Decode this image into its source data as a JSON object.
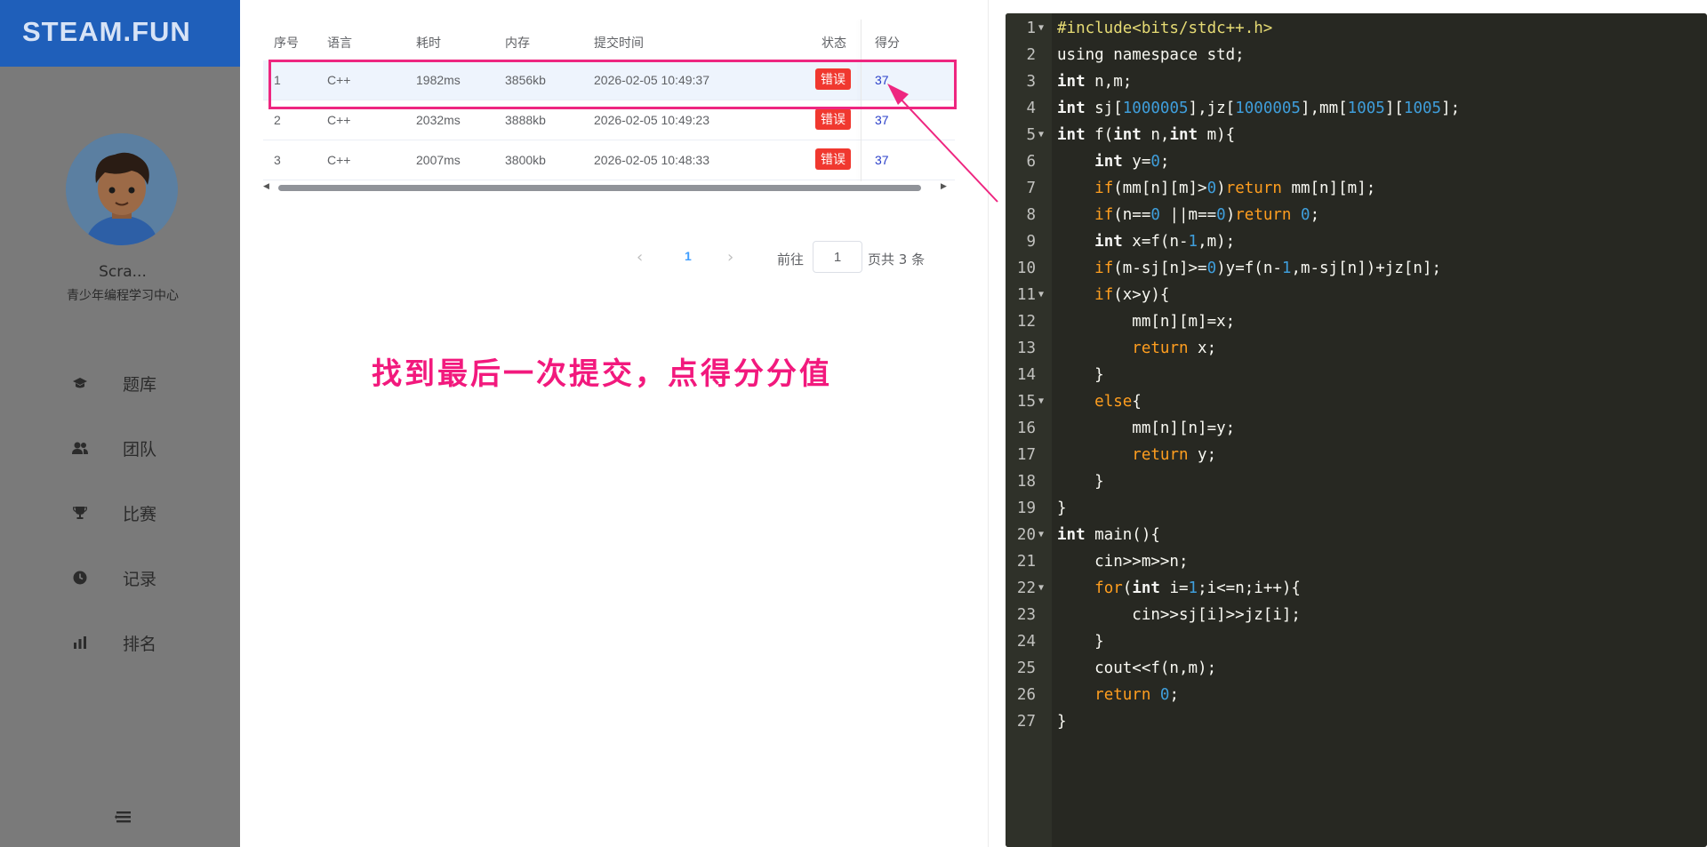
{
  "sidebar": {
    "logo": "STEAM.FUN",
    "user_name": "Scra...",
    "user_org": "青少年编程学习中心",
    "nav": [
      {
        "label": "题库",
        "icon": "question-bank-icon"
      },
      {
        "label": "团队",
        "icon": "team-icon"
      },
      {
        "label": "比赛",
        "icon": "trophy-icon"
      },
      {
        "label": "记录",
        "icon": "clock-icon"
      },
      {
        "label": "排名",
        "icon": "bar-chart-icon"
      }
    ],
    "collapse_icon": "menu-collapse-icon"
  },
  "table": {
    "headers": [
      "序号",
      "语言",
      "耗时",
      "内存",
      "提交时间",
      "状态",
      "得分"
    ],
    "rows": [
      {
        "index": "1",
        "lang": "C++",
        "time": "1982ms",
        "memory": "3856kb",
        "submitted": "2026-02-05 10:49:37",
        "status": "错误",
        "score": "37"
      },
      {
        "index": "2",
        "lang": "C++",
        "time": "2032ms",
        "memory": "3888kb",
        "submitted": "2026-02-05 10:49:23",
        "status": "错误",
        "score": "37"
      },
      {
        "index": "3",
        "lang": "C++",
        "time": "2007ms",
        "memory": "3800kb",
        "submitted": "2026-02-05 10:48:33",
        "status": "错误",
        "score": "37"
      }
    ]
  },
  "pagination": {
    "current": "1",
    "goto_label": "前往",
    "goto_value": "1",
    "total_label": "页共 3 条"
  },
  "annotation": {
    "text": "找到最后一次提交，点得分分值",
    "color": "#ee2680"
  },
  "editor": {
    "lines": [
      {
        "n": "1",
        "fold": true
      },
      {
        "n": "2",
        "fold": false
      },
      {
        "n": "3",
        "fold": false
      },
      {
        "n": "4",
        "fold": false
      },
      {
        "n": "5",
        "fold": true
      },
      {
        "n": "6",
        "fold": false
      },
      {
        "n": "7",
        "fold": false
      },
      {
        "n": "8",
        "fold": false
      },
      {
        "n": "9",
        "fold": false
      },
      {
        "n": "10",
        "fold": false
      },
      {
        "n": "11",
        "fold": true
      },
      {
        "n": "12",
        "fold": false
      },
      {
        "n": "13",
        "fold": false
      },
      {
        "n": "14",
        "fold": false
      },
      {
        "n": "15",
        "fold": true
      },
      {
        "n": "16",
        "fold": false
      },
      {
        "n": "17",
        "fold": false
      },
      {
        "n": "18",
        "fold": false
      },
      {
        "n": "19",
        "fold": false
      },
      {
        "n": "20",
        "fold": true
      },
      {
        "n": "21",
        "fold": false
      },
      {
        "n": "22",
        "fold": true
      },
      {
        "n": "23",
        "fold": false
      },
      {
        "n": "24",
        "fold": false
      },
      {
        "n": "25",
        "fold": false
      },
      {
        "n": "26",
        "fold": false
      },
      {
        "n": "27",
        "fold": false
      }
    ],
    "code": [
      "#include<bits/stdc++.h>",
      "using namespace std;",
      "int n,m;",
      "int sj[1000005],jz[1000005],mm[1005][1005];",
      "int f(int n,int m){",
      "    int y=0;",
      "    if(mm[n][m]>0)return mm[n][m];",
      "    if(n==0 ||m==0)return 0;",
      "    int x=f(n-1,m);",
      "    if(m-sj[n]>=0)y=f(n-1,m-sj[n])+jz[n];",
      "    if(x>y){",
      "        mm[n][m]=x;",
      "        return x;",
      "    }",
      "    else{",
      "        mm[n][n]=y;",
      "        return y;",
      "    }",
      "}",
      "int main(){",
      "    cin>>m>>n;",
      "    for(int i=1;i<=n;i++){",
      "        cin>>sj[i]>>jz[i];",
      "    }",
      "    cout<<f(n,m);",
      "    return 0;",
      "}"
    ]
  },
  "colors": {
    "logo_bar": "#1f5fba",
    "sidebar": "#7a7a7a",
    "status_error": "#f0382f",
    "score_link": "#2a3fc9",
    "instruction": "#f2197d",
    "editor_bg": "#272822",
    "keyword_control": "#ff9e1f",
    "number": "#3f9edb"
  }
}
